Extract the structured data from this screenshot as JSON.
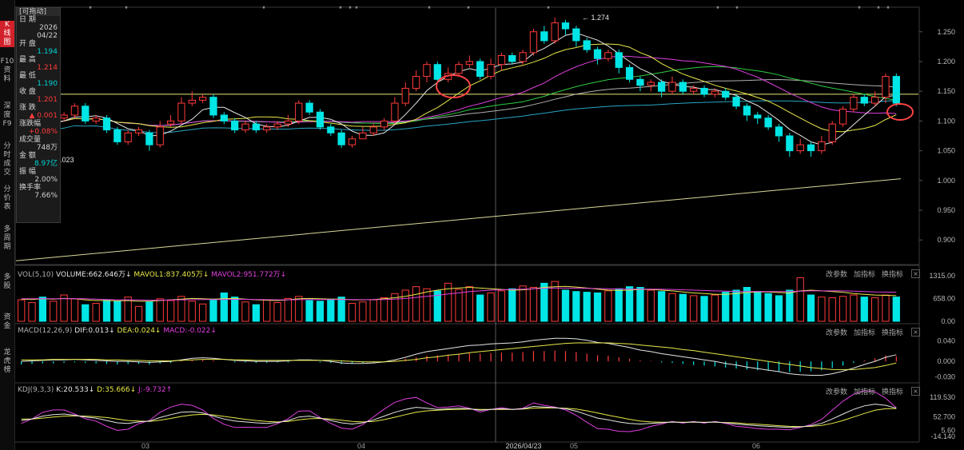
{
  "sidebar": {
    "items": [
      {
        "label": "K\n线\n图",
        "active": true
      },
      {
        "label": "F10\n资\n料"
      },
      {
        "label": "深\n度\nF9"
      },
      {
        "label": "分\n时\n成\n交"
      },
      {
        "label": "分\n价\n表"
      },
      {
        "label": "多\n周\n期"
      },
      {
        "label": "多\n股"
      },
      {
        "label": "资\n金"
      },
      {
        "label": "龙\n虎\n榜"
      }
    ]
  },
  "info_panel": {
    "header": "[可拖动]",
    "rows": [
      {
        "label": "日 期",
        "value": "2026\n04/22",
        "color": "#d0d0d0"
      },
      {
        "label": "开 盘",
        "value": "1.194",
        "color": "#00d5d5"
      },
      {
        "label": "最 高",
        "value": "1.214",
        "color": "#ff3b3b"
      },
      {
        "label": "最 低",
        "value": "1.190",
        "color": "#00d5d5"
      },
      {
        "label": "收 盘",
        "value": "1.201",
        "color": "#ff3b3b"
      },
      {
        "label": "涨 跌",
        "value": "▲ 0.001",
        "color": "#ff3b3b"
      },
      {
        "label": "涨跌幅",
        "value": "+0.08%",
        "color": "#ff3b3b"
      },
      {
        "label": "成交量",
        "value": "748万",
        "color": "#d0d0d0"
      },
      {
        "label": "金 额",
        "value": "8.97亿",
        "color": "#00d5d5"
      },
      {
        "label": "振 幅",
        "value": "2.00%",
        "color": "#d0d0d0"
      },
      {
        "label": "换手率",
        "value": "7.66%",
        "color": "#d0d0d0"
      }
    ]
  },
  "main_axis": {
    "ticks": [
      "1.250",
      "1.200",
      "1.150",
      "1.100",
      "1.050",
      "1.000",
      "0.950",
      "0.900"
    ],
    "tick_values": [
      1.25,
      1.2,
      1.15,
      1.1,
      1.05,
      1.0,
      0.95,
      0.9
    ]
  },
  "annotations": {
    "peak_label": "1.274",
    "low_label": "1.023",
    "peak_value": 1.274,
    "low_value": 1.023
  },
  "x_axis": {
    "labels": [
      "03",
      "04",
      "2026/04/23",
      "05",
      "06"
    ]
  },
  "vol_panel": {
    "title": "VOL(5,10)",
    "items": [
      {
        "text": "VOLUME:662.646万↓",
        "color": "#e6e6e6"
      },
      {
        "text": "MAVOL1:837.405万↓",
        "color": "#e8e84a"
      },
      {
        "text": "MAVOL2:951.772万↓",
        "color": "#e040e0"
      }
    ],
    "ticks": [
      "1315.00",
      "658.00",
      "0.00"
    ],
    "tick_values": [
      1315,
      658,
      0
    ]
  },
  "macd_panel": {
    "title": "MACD(12,26,9)",
    "items": [
      {
        "text": "DIF:0.013↓",
        "color": "#e6e6e6"
      },
      {
        "text": "DEA:0.024↓",
        "color": "#e8e84a"
      },
      {
        "text": "MACD:-0.022↓",
        "color": "#e040e0"
      }
    ],
    "ticks": [
      "0.040",
      "0.000",
      "-0.030"
    ],
    "tick_values": [
      0.04,
      0.0,
      -0.03
    ]
  },
  "kdj_panel": {
    "title": "KDJ(9,3,3)",
    "items": [
      {
        "text": "K:20.533↓",
        "color": "#e6e6e6"
      },
      {
        "text": "D:35.666↓",
        "color": "#e8e84a"
      },
      {
        "text": "J:-9.732↑",
        "color": "#e040e0"
      }
    ],
    "ticks": [
      "119.530",
      "52.700",
      "5.60",
      "-14.140"
    ],
    "tick_values": [
      119.53,
      52.7,
      5.6,
      -14.14
    ]
  },
  "panel_buttons": {
    "params": "改参数",
    "add": "加指标",
    "switch": "换指标",
    "close": "×"
  },
  "colors": {
    "up": "#ff3b3b",
    "down": "#00e5e5",
    "ma5": "#e6e6e6",
    "ma10": "#e8e84a",
    "ma20": "#e040e0",
    "ma30": "#2ecc40",
    "ma60": "#b0b0b0",
    "ma120": "#27a5c4",
    "ma250": "#d9d99a",
    "hline": "#e6e67a",
    "circle": "#ff4444"
  },
  "chart_data": {
    "type": "candlestick",
    "reference_line": 1.145,
    "candles": [
      [
        1.08,
        1.09,
        1.095,
        1.075
      ],
      [
        1.09,
        1.1,
        1.105,
        1.085
      ],
      [
        1.105,
        1.095,
        1.11,
        1.09
      ],
      [
        1.095,
        1.105,
        1.11,
        1.09
      ],
      [
        1.105,
        1.11,
        1.115,
        1.1
      ],
      [
        1.11,
        1.125,
        1.13,
        1.105
      ],
      [
        1.125,
        1.1,
        1.13,
        1.095
      ],
      [
        1.1,
        1.105,
        1.11,
        1.095
      ],
      [
        1.105,
        1.085,
        1.11,
        1.08
      ],
      [
        1.085,
        1.065,
        1.09,
        1.06
      ],
      [
        1.065,
        1.08,
        1.085,
        1.06
      ],
      [
        1.08,
        1.085,
        1.09,
        1.075
      ],
      [
        1.08,
        1.06,
        1.085,
        1.05
      ],
      [
        1.06,
        1.09,
        1.1,
        1.055
      ],
      [
        1.095,
        1.1,
        1.11,
        1.09
      ],
      [
        1.1,
        1.13,
        1.14,
        1.095
      ],
      [
        1.13,
        1.135,
        1.15,
        1.125
      ],
      [
        1.135,
        1.14,
        1.145,
        1.13
      ],
      [
        1.14,
        1.11,
        1.145,
        1.105
      ],
      [
        1.11,
        1.1,
        1.115,
        1.095
      ],
      [
        1.1,
        1.085,
        1.105,
        1.08
      ],
      [
        1.085,
        1.095,
        1.1,
        1.08
      ],
      [
        1.095,
        1.085,
        1.1,
        1.08
      ],
      [
        1.085,
        1.09,
        1.095,
        1.08
      ],
      [
        1.09,
        1.095,
        1.1,
        1.085
      ],
      [
        1.095,
        1.1,
        1.11,
        1.09
      ],
      [
        1.1,
        1.13,
        1.135,
        1.095
      ],
      [
        1.13,
        1.115,
        1.135,
        1.11
      ],
      [
        1.115,
        1.09,
        1.12,
        1.085
      ],
      [
        1.09,
        1.08,
        1.095,
        1.075
      ],
      [
        1.08,
        1.06,
        1.085,
        1.055
      ],
      [
        1.06,
        1.07,
        1.075,
        1.055
      ],
      [
        1.07,
        1.08,
        1.09,
        1.07
      ],
      [
        1.08,
        1.09,
        1.095,
        1.075
      ],
      [
        1.09,
        1.1,
        1.105,
        1.085
      ],
      [
        1.1,
        1.13,
        1.14,
        1.095
      ],
      [
        1.13,
        1.155,
        1.165,
        1.125
      ],
      [
        1.155,
        1.175,
        1.185,
        1.15
      ],
      [
        1.175,
        1.195,
        1.2,
        1.165
      ],
      [
        1.195,
        1.17,
        1.2,
        1.165
      ],
      [
        1.17,
        1.18,
        1.19,
        1.165
      ],
      [
        1.18,
        1.195,
        1.2,
        1.175
      ],
      [
        1.195,
        1.2,
        1.21,
        1.19
      ],
      [
        1.2,
        1.175,
        1.205,
        1.17
      ],
      [
        1.175,
        1.195,
        1.205,
        1.17
      ],
      [
        1.195,
        1.21,
        1.215,
        1.185
      ],
      [
        1.21,
        1.2,
        1.215,
        1.195
      ],
      [
        1.2,
        1.215,
        1.22,
        1.195
      ],
      [
        1.215,
        1.25,
        1.255,
        1.21
      ],
      [
        1.25,
        1.235,
        1.26,
        1.23
      ],
      [
        1.235,
        1.265,
        1.274,
        1.23
      ],
      [
        1.265,
        1.255,
        1.27,
        1.245
      ],
      [
        1.255,
        1.235,
        1.26,
        1.225
      ],
      [
        1.235,
        1.22,
        1.24,
        1.215
      ],
      [
        1.22,
        1.205,
        1.225,
        1.195
      ],
      [
        1.205,
        1.215,
        1.22,
        1.2
      ],
      [
        1.215,
        1.19,
        1.22,
        1.18
      ],
      [
        1.19,
        1.17,
        1.195,
        1.165
      ],
      [
        1.17,
        1.16,
        1.175,
        1.15
      ],
      [
        1.16,
        1.165,
        1.17,
        1.15
      ],
      [
        1.165,
        1.15,
        1.17,
        1.14
      ],
      [
        1.15,
        1.165,
        1.175,
        1.145
      ],
      [
        1.165,
        1.15,
        1.17,
        1.145
      ],
      [
        1.15,
        1.155,
        1.16,
        1.145
      ],
      [
        1.155,
        1.145,
        1.16,
        1.14
      ],
      [
        1.145,
        1.15,
        1.155,
        1.14
      ],
      [
        1.15,
        1.14,
        1.155,
        1.135
      ],
      [
        1.14,
        1.125,
        1.145,
        1.12
      ],
      [
        1.125,
        1.11,
        1.13,
        1.1
      ],
      [
        1.11,
        1.105,
        1.115,
        1.095
      ],
      [
        1.105,
        1.09,
        1.11,
        1.085
      ],
      [
        1.09,
        1.075,
        1.095,
        1.065
      ],
      [
        1.075,
        1.05,
        1.08,
        1.04
      ],
      [
        1.05,
        1.06,
        1.07,
        1.045
      ],
      [
        1.06,
        1.05,
        1.065,
        1.04
      ],
      [
        1.05,
        1.065,
        1.075,
        1.045
      ],
      [
        1.065,
        1.095,
        1.1,
        1.06
      ],
      [
        1.095,
        1.12,
        1.125,
        1.09
      ],
      [
        1.12,
        1.14,
        1.145,
        1.115
      ],
      [
        1.14,
        1.13,
        1.145,
        1.125
      ],
      [
        1.13,
        1.14,
        1.15,
        1.125
      ],
      [
        1.14,
        1.175,
        1.18,
        1.13
      ],
      [
        1.175,
        1.13,
        1.18,
        1.125
      ]
    ],
    "volume": [
      620,
      540,
      700,
      580,
      760,
      650,
      480,
      520,
      610,
      580,
      700,
      430,
      560,
      650,
      600,
      720,
      580,
      500,
      640,
      820,
      700,
      560,
      480,
      620,
      540,
      660,
      720,
      600,
      580,
      640,
      700,
      520,
      560,
      620,
      680,
      800,
      900,
      1000,
      940,
      880,
      1100,
      920,
      1000,
      760,
      820,
      880,
      940,
      1020,
      980,
      1100,
      1150,
      900,
      860,
      840,
      820,
      880,
      940,
      1000,
      980,
      900,
      860,
      800,
      780,
      740,
      720,
      760,
      840,
      900,
      980,
      860,
      800,
      740,
      900,
      1260,
      760,
      700,
      680,
      720,
      760,
      700,
      680,
      760,
      700
    ],
    "mavol1": [
      640,
      630,
      650,
      640,
      660,
      650,
      620,
      600,
      600,
      590,
      600,
      580,
      580,
      600,
      620,
      640,
      660,
      650,
      640,
      650,
      660,
      640,
      620,
      610,
      600,
      620,
      650,
      660,
      650,
      640,
      640,
      620,
      620,
      630,
      650,
      680,
      720,
      780,
      850,
      900,
      940,
      960,
      980,
      960,
      940,
      920,
      900,
      910,
      940,
      980,
      1000,
      1010,
      990,
      960,
      930,
      900,
      890,
      900,
      920,
      920,
      900,
      880,
      850,
      820,
      800,
      780,
      780,
      800,
      830,
      850,
      850,
      830,
      820,
      880,
      900,
      880,
      860,
      840,
      800,
      780,
      760,
      750,
      740
    ],
    "mavol2": [
      650,
      650,
      655,
      650,
      650,
      655,
      650,
      640,
      630,
      620,
      620,
      615,
      610,
      610,
      615,
      620,
      625,
      630,
      630,
      630,
      635,
      635,
      630,
      625,
      620,
      620,
      625,
      630,
      630,
      630,
      630,
      630,
      625,
      625,
      630,
      640,
      660,
      690,
      720,
      750,
      790,
      820,
      860,
      880,
      900,
      910,
      920,
      930,
      940,
      950,
      960,
      960,
      955,
      950,
      945,
      940,
      935,
      930,
      930,
      930,
      925,
      920,
      910,
      900,
      890,
      880,
      870,
      860,
      860,
      860,
      860,
      860,
      860,
      870,
      880,
      880,
      880,
      880,
      870,
      860,
      850,
      845,
      840
    ],
    "macd": [
      -0.006,
      -0.005,
      -0.004,
      -0.004,
      -0.003,
      -0.002,
      -0.003,
      -0.004,
      -0.005,
      -0.006,
      -0.005,
      -0.005,
      -0.006,
      -0.004,
      -0.003,
      0.001,
      0.003,
      0.004,
      0.002,
      0.0,
      -0.002,
      -0.002,
      -0.003,
      -0.003,
      -0.002,
      -0.002,
      0.0,
      0.0,
      -0.002,
      -0.003,
      -0.005,
      -0.004,
      -0.003,
      -0.002,
      -0.001,
      0.002,
      0.005,
      0.008,
      0.011,
      0.012,
      0.013,
      0.015,
      0.016,
      0.015,
      0.016,
      0.017,
      0.017,
      0.018,
      0.02,
      0.02,
      0.021,
      0.02,
      0.018,
      0.015,
      0.012,
      0.011,
      0.008,
      0.005,
      0.002,
      0.001,
      -0.002,
      -0.003,
      -0.005,
      -0.007,
      -0.008,
      -0.01,
      -0.012,
      -0.014,
      -0.016,
      -0.017,
      -0.018,
      -0.019,
      -0.021,
      -0.02,
      -0.019,
      -0.017,
      -0.013,
      -0.008,
      -0.003,
      0.002,
      0.006,
      0.012,
      0.01
    ],
    "dif": [
      0.0,
      0.001,
      0.002,
      0.003,
      0.003,
      0.004,
      0.003,
      0.002,
      0.001,
      0.0,
      0.0,
      -0.001,
      -0.002,
      -0.001,
      0.0,
      0.003,
      0.006,
      0.007,
      0.006,
      0.004,
      0.002,
      0.001,
      0.0,
      0.0,
      0.0,
      0.001,
      0.003,
      0.003,
      0.002,
      0.0,
      -0.003,
      -0.004,
      -0.004,
      -0.003,
      -0.001,
      0.003,
      0.008,
      0.014,
      0.019,
      0.022,
      0.025,
      0.028,
      0.031,
      0.032,
      0.034,
      0.035,
      0.036,
      0.038,
      0.041,
      0.043,
      0.045,
      0.045,
      0.044,
      0.041,
      0.037,
      0.035,
      0.031,
      0.027,
      0.022,
      0.019,
      0.015,
      0.012,
      0.009,
      0.006,
      0.003,
      0.0,
      -0.004,
      -0.007,
      -0.011,
      -0.014,
      -0.017,
      -0.02,
      -0.024,
      -0.026,
      -0.027,
      -0.027,
      -0.024,
      -0.019,
      -0.013,
      -0.006,
      0.0,
      0.008,
      0.013
    ],
    "dea": [
      0.003,
      0.003,
      0.003,
      0.004,
      0.004,
      0.004,
      0.004,
      0.004,
      0.003,
      0.003,
      0.002,
      0.002,
      0.001,
      0.001,
      0.001,
      0.002,
      0.003,
      0.004,
      0.004,
      0.004,
      0.003,
      0.003,
      0.002,
      0.002,
      0.002,
      0.002,
      0.002,
      0.002,
      0.002,
      0.002,
      0.001,
      0.0,
      -0.001,
      -0.001,
      -0.001,
      0.0,
      0.002,
      0.004,
      0.007,
      0.009,
      0.012,
      0.014,
      0.017,
      0.019,
      0.021,
      0.023,
      0.025,
      0.027,
      0.029,
      0.031,
      0.033,
      0.035,
      0.036,
      0.036,
      0.036,
      0.036,
      0.035,
      0.034,
      0.032,
      0.03,
      0.028,
      0.026,
      0.023,
      0.021,
      0.018,
      0.015,
      0.012,
      0.009,
      0.006,
      0.003,
      0.0,
      -0.003,
      -0.006,
      -0.009,
      -0.012,
      -0.014,
      -0.016,
      -0.016,
      -0.016,
      -0.014,
      -0.012,
      -0.008,
      -0.003
    ],
    "k": [
      40,
      45,
      55,
      60,
      62,
      58,
      52,
      48,
      40,
      32,
      30,
      35,
      38,
      50,
      60,
      68,
      70,
      66,
      55,
      45,
      38,
      35,
      32,
      30,
      33,
      40,
      52,
      55,
      48,
      40,
      32,
      28,
      32,
      42,
      55,
      68,
      78,
      85,
      82,
      78,
      80,
      82,
      80,
      75,
      78,
      80,
      78,
      80,
      88,
      86,
      84,
      80,
      72,
      60,
      48,
      42,
      35,
      30,
      28,
      30,
      32,
      35,
      33,
      35,
      33,
      35,
      32,
      28,
      25,
      22,
      20,
      18,
      16,
      18,
      22,
      30,
      45,
      62,
      78,
      90,
      96,
      92,
      82
    ],
    "d": [
      45,
      45,
      48,
      52,
      55,
      56,
      55,
      53,
      50,
      45,
      40,
      38,
      37,
      41,
      47,
      54,
      59,
      61,
      59,
      54,
      49,
      44,
      40,
      37,
      35,
      37,
      42,
      46,
      47,
      45,
      41,
      37,
      35,
      37,
      43,
      51,
      60,
      68,
      73,
      75,
      77,
      78,
      79,
      78,
      78,
      78,
      78,
      79,
      82,
      83,
      83,
      82,
      79,
      73,
      66,
      58,
      51,
      44,
      38,
      35,
      34,
      34,
      34,
      34,
      34,
      34,
      33,
      32,
      29,
      27,
      25,
      22,
      20,
      19,
      20,
      23,
      30,
      40,
      52,
      64,
      75,
      80,
      81
    ],
    "j": [
      30,
      45,
      68,
      76,
      76,
      62,
      46,
      38,
      20,
      6,
      10,
      29,
      40,
      68,
      86,
      96,
      92,
      76,
      47,
      27,
      16,
      17,
      16,
      16,
      29,
      46,
      72,
      73,
      50,
      30,
      14,
      10,
      26,
      52,
      79,
      102,
      114,
      119,
      100,
      84,
      86,
      90,
      82,
      69,
      78,
      84,
      78,
      82,
      100,
      92,
      86,
      76,
      58,
      34,
      12,
      10,
      3,
      2,
      8,
      20,
      28,
      37,
      31,
      37,
      31,
      37,
      30,
      20,
      17,
      12,
      10,
      10,
      8,
      16,
      26,
      44,
      75,
      106,
      130,
      142,
      138,
      116,
      84
    ]
  }
}
